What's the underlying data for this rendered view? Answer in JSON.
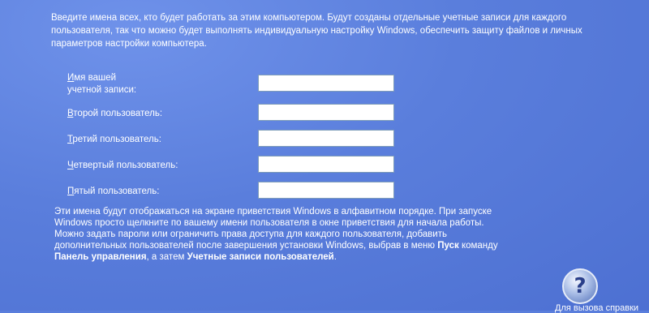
{
  "intro": "Введите имена всех, кто будет работать за этим компьютером. Будут созданы отдельные учетные записи для каждого пользователя, так что можно будет выполнять индивидуальную настройку Windows, обеспечить защиту файлов и личных параметров настройки компьютера.",
  "fields": [
    {
      "label_ul": "И",
      "label_rest": "мя вашей",
      "label_line2": "учетной записи:",
      "value": ""
    },
    {
      "label_ul": "В",
      "label_rest": "торой пользователь:",
      "value": ""
    },
    {
      "label_ul": "Т",
      "label_rest": "ретий пользователь:",
      "value": ""
    },
    {
      "label_ul": "Ч",
      "label_rest": "етвертый пользователь:",
      "value": ""
    },
    {
      "label_ul": "П",
      "label_rest": "ятый пользователь:",
      "value": ""
    }
  ],
  "note": {
    "line1": "Эти имена будут отображаться на экране приветствия Windows в алфавитном порядке. При запуске",
    "line2": "Windows просто щелкните по вашему имени пользователя в окне приветствия для начала работы.",
    "line3": "Можно задать пароли или ограничить права доступа для каждого пользователя, добавить",
    "line4a": "дополнительных пользователей после завершения установки Windows, выбрав в меню ",
    "line4b": "Пуск",
    "line4c": " команду",
    "line5a": "Панель управления",
    "line5b": ", а затем ",
    "line5c": "Учетные записи пользователей",
    "line5d": "."
  },
  "help": {
    "icon": "help-icon",
    "glyph": "?",
    "label": "Для вызова справки"
  },
  "colors": {
    "background": "#5a7edc",
    "text": "#ffffff",
    "field_border": "#7f9db9"
  }
}
